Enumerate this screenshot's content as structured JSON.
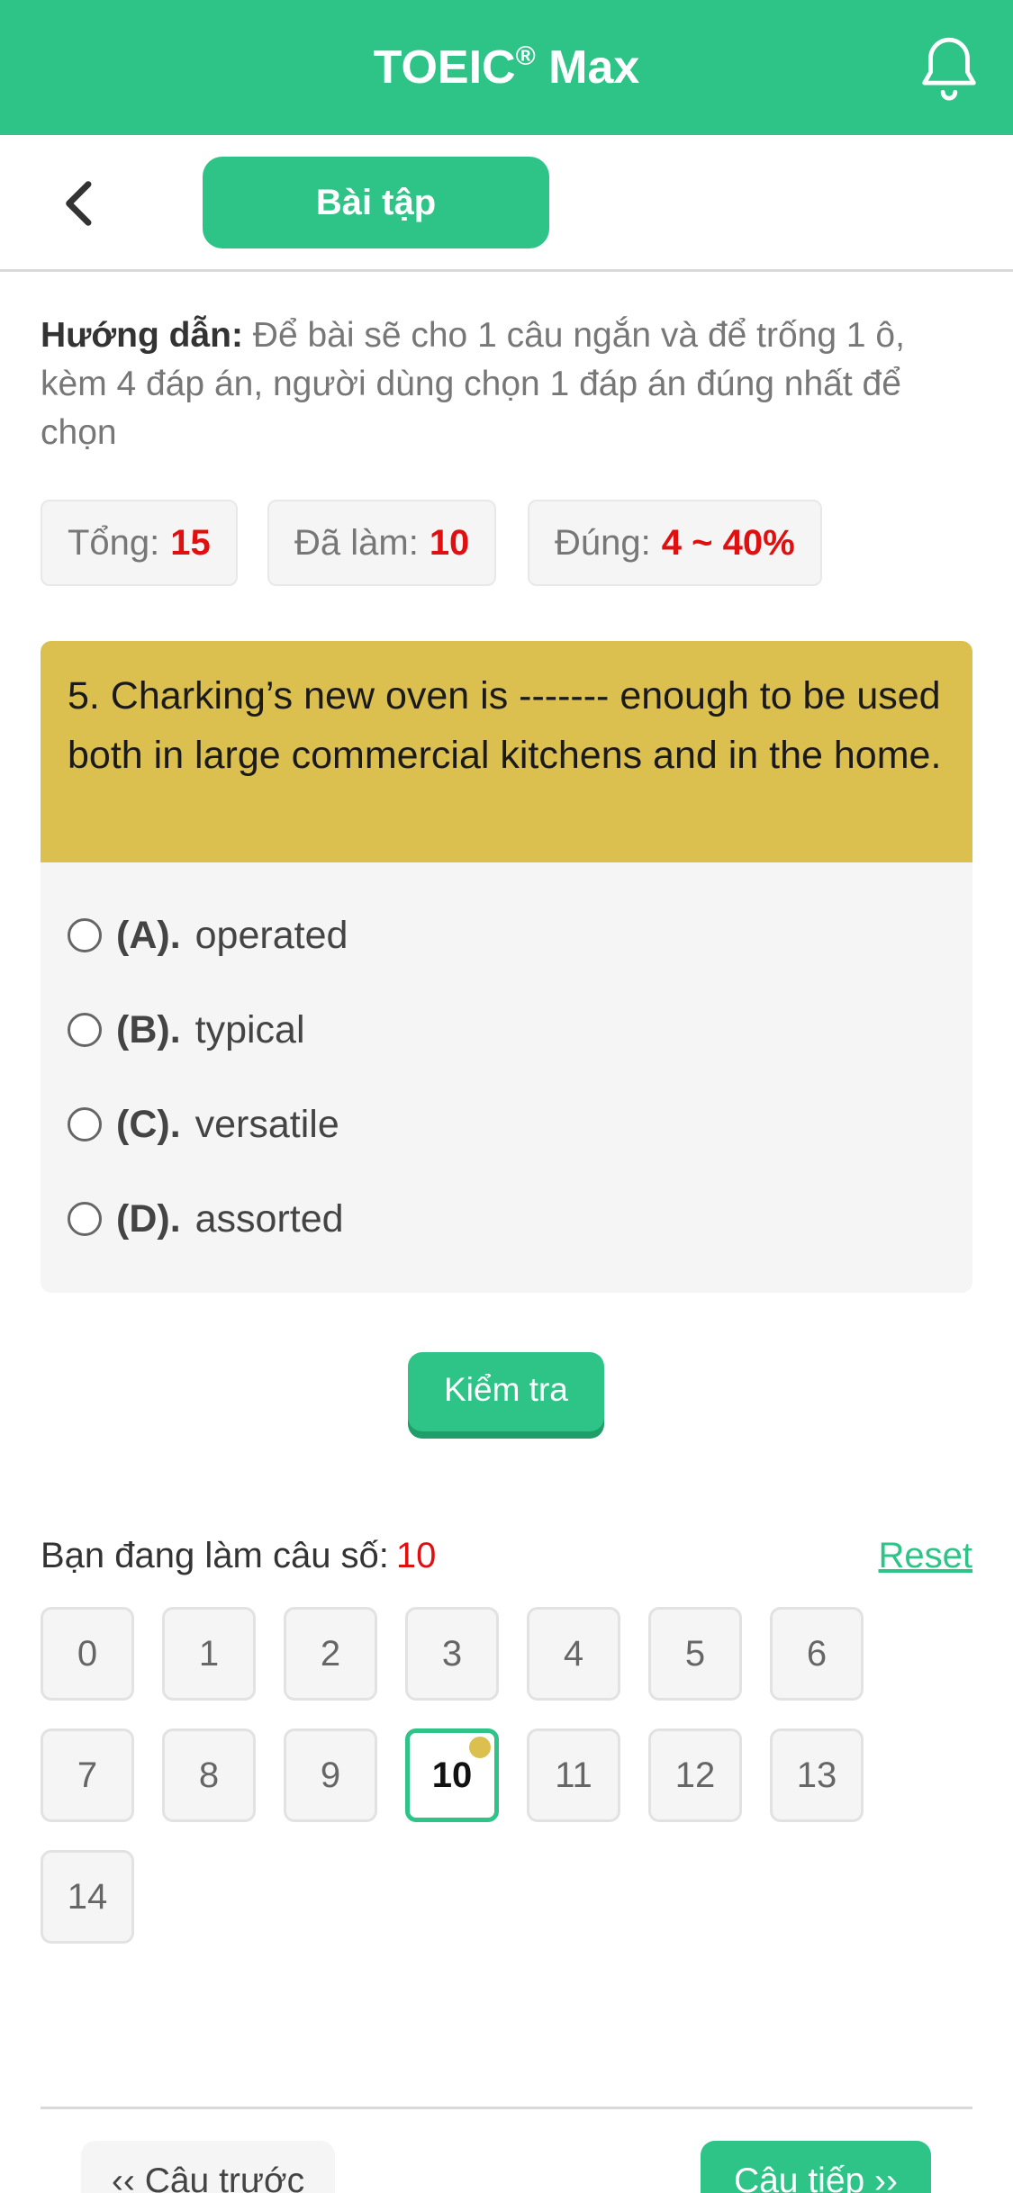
{
  "header": {
    "title": "TOEIC",
    "title_mark": "®",
    "title_suffix": " Max"
  },
  "subbar": {
    "tab_label": "Bài tập"
  },
  "instructions": {
    "label": "Hướng dẫn:",
    "text": " Để bài sẽ cho 1 câu ngắn và để trống 1 ô, kèm 4 đáp án, người dùng chọn 1 đáp án đúng nhất để chọn"
  },
  "stats": {
    "total_label": "Tổng:",
    "total_value": "15",
    "done_label": "Đã làm:",
    "done_value": "10",
    "correct_label": "Đúng:",
    "correct_value": "4 ~ 40%"
  },
  "question": {
    "text": "5. Charking’s new oven is ------- enough to be used both in large commercial kitchens and in the home.",
    "options": [
      {
        "key": "(A).",
        "text": "operated"
      },
      {
        "key": "(B).",
        "text": "typical"
      },
      {
        "key": "(C).",
        "text": "versatile"
      },
      {
        "key": "(D).",
        "text": "assorted"
      }
    ]
  },
  "check_button": "Kiểm tra",
  "progress": {
    "label": "Bạn đang làm câu số:",
    "current": "10",
    "reset_label": "Reset",
    "questions": [
      "0",
      "1",
      "2",
      "3",
      "4",
      "5",
      "6",
      "7",
      "8",
      "9",
      "10",
      "11",
      "12",
      "13",
      "14"
    ],
    "active_index": 10
  },
  "nav": {
    "prev_label": "‹‹ Câu trước",
    "next_label": "Câu tiếp ››"
  },
  "colors": {
    "brand": "#2ec488",
    "question_bg": "#dbbf4f",
    "highlight": "#e01010"
  }
}
